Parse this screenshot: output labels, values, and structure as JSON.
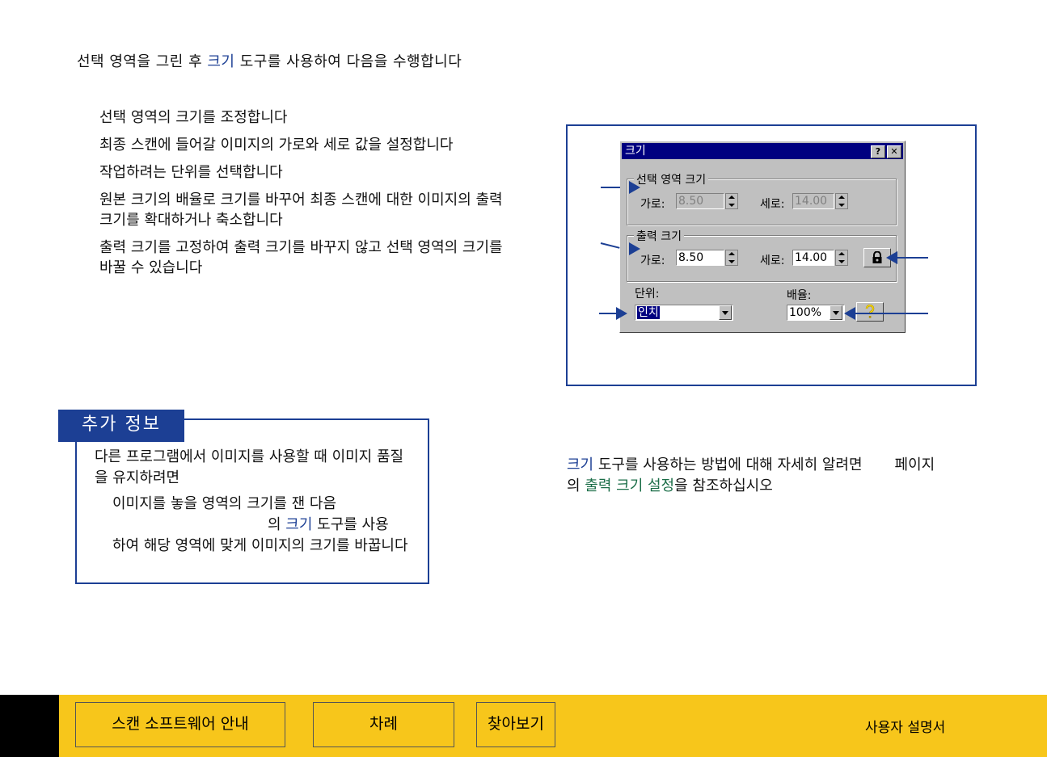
{
  "intro": {
    "part1": "선택 영역을 그린 후 ",
    "tool": "크기",
    "part2": " 도구를 사용하여 다음을 수행합니다"
  },
  "bullets": [
    "선택 영역의 크기를 조정합니다",
    "최종 스캔에 들어갈 이미지의 가로와 세로 값을 설정합니다",
    "작업하려는 단위를 선택합니다",
    "원본 크기의 배율로 크기를 바꾸어 최종 스캔에 대한 이미지의 출력 크기를 확대하거나 축소합니다",
    "출력 크기를 고정하여 출력 크기를 바꾸지 않고 선택 영역의 크기를 바꿀 수 있습니다"
  ],
  "dialog": {
    "title": "크기",
    "help_btn": "?",
    "close_btn": "✕",
    "selection_group": "선택 영역 크기",
    "output_group": "출력 크기",
    "width_label": "가로:",
    "height_label": "세로:",
    "sel_width": "8.50",
    "sel_height": "14.00",
    "out_width": "8.50",
    "out_height": "14.00",
    "units_label": "단위:",
    "units_value": "인치",
    "scale_label": "배율:",
    "scale_value": "100%",
    "lock_icon": "lock-icon",
    "help_icon": "question-icon"
  },
  "info": {
    "tab": "추가 정보",
    "text": "다른 프로그램에서 이미지를 사용할 때 이미지 품질을 유지하려면",
    "sub1": "이미지를 놓을 영역의 크기를 잰 다음",
    "sub2a": "의 ",
    "sub2tool": "크기",
    "sub2b": " 도구를 사용",
    "sub3": "하여 해당 영역에 맞게 이미지의 크기를 바꿉니다"
  },
  "caption": {
    "tool": "크기",
    "part1": " 도구를 사용하는 방법에 대해 자세히 알려면",
    "part2": "페이지",
    "part3": "의 ",
    "link": "출력 크기 설정",
    "part4": "을 참조하십시오"
  },
  "footer": {
    "btn1": "스캔 소프트웨어 안내",
    "btn2": "차례",
    "btn3": "찾아보기",
    "title": "사용자 설명서"
  },
  "colors": {
    "accent": "#1c3f94",
    "footer": "#f7c61b",
    "link": "#1a6d47"
  }
}
